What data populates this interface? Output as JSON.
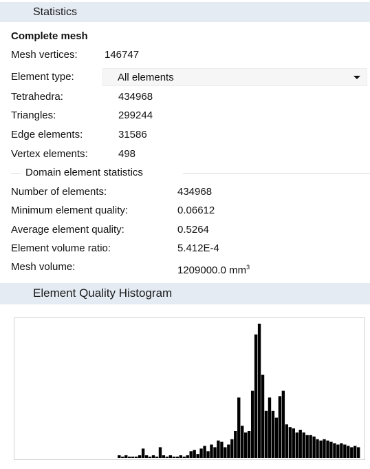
{
  "statistics_header": "Statistics",
  "complete_mesh": {
    "title": "Complete mesh",
    "vertices_label": "Mesh vertices:",
    "vertices_value": "146747",
    "element_type_label": "Element type:",
    "element_type_value": "All elements",
    "rows": [
      {
        "label": "Tetrahedra:",
        "value": "434968"
      },
      {
        "label": "Triangles:",
        "value": "299244"
      },
      {
        "label": "Edge elements:",
        "value": "31586"
      },
      {
        "label": "Vertex elements:",
        "value": "498"
      }
    ]
  },
  "domain_stats": {
    "title": "Domain element statistics",
    "rows": [
      {
        "label": "Number of elements:",
        "value": "434968"
      },
      {
        "label": "Minimum element quality:",
        "value": "0.06612"
      },
      {
        "label": "Average element quality:",
        "value": "0.5264"
      },
      {
        "label": "Element volume ratio:",
        "value": "5.412E-4"
      }
    ],
    "mesh_volume_label": "Mesh volume:",
    "mesh_volume_value": "1209000.0 mm",
    "mesh_volume_sup": "3"
  },
  "histogram_header": "Element Quality Histogram",
  "chart_data": {
    "type": "bar",
    "x_range": [
      0,
      1
    ],
    "bins": 100,
    "ylabel": "",
    "xlabel": "",
    "values": [
      0,
      0,
      0,
      0,
      0,
      0,
      0,
      0,
      0,
      0,
      0,
      0,
      0,
      0,
      0,
      0,
      0,
      0,
      0,
      0,
      0,
      0,
      0,
      0,
      0,
      0,
      0,
      0,
      0,
      0.02,
      0.01,
      0.02,
      0.01,
      0.01,
      0.01,
      0.02,
      0.07,
      0.02,
      0.01,
      0.02,
      0.01,
      0.08,
      0.02,
      0.01,
      0.02,
      0.01,
      0.01,
      0.02,
      0.01,
      0.02,
      0.05,
      0.06,
      0.03,
      0.07,
      0.09,
      0.05,
      0.1,
      0.08,
      0.13,
      0.12,
      0.08,
      0.1,
      0.14,
      0.2,
      0.45,
      0.24,
      0.19,
      0.2,
      0.5,
      0.92,
      1.0,
      0.62,
      0.35,
      0.45,
      0.35,
      0.3,
      0.46,
      0.5,
      0.25,
      0.23,
      0.22,
      0.19,
      0.21,
      0.19,
      0.17,
      0.17,
      0.16,
      0.14,
      0.13,
      0.14,
      0.13,
      0.12,
      0.11,
      0.1,
      0.11,
      0.1,
      0.09,
      0.08,
      0.09,
      0.08
    ]
  },
  "colors": {
    "header_bg": "#e4ebf3",
    "bar": "#000000",
    "divider": "#dcdcdc"
  }
}
